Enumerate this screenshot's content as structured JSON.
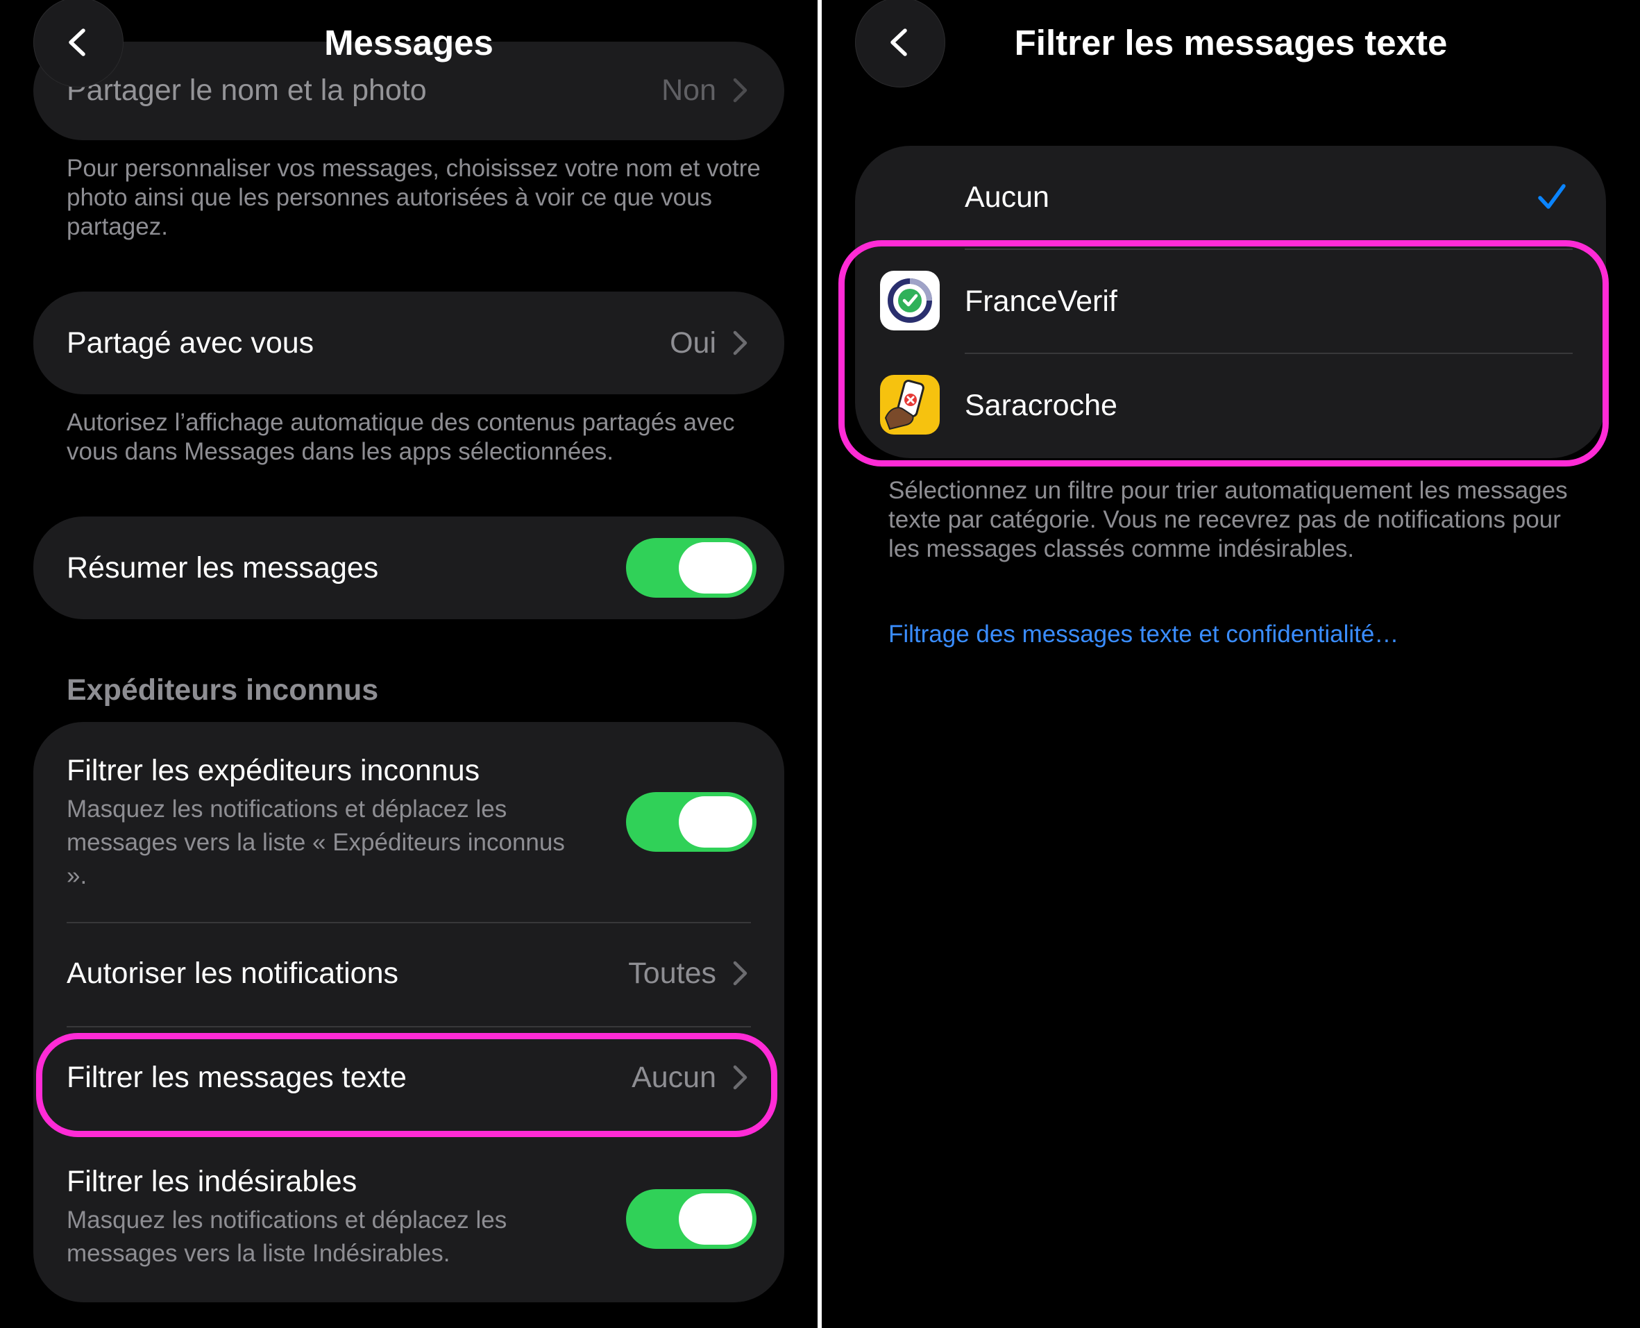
{
  "colors": {
    "accent": "#0a84ff",
    "toggle_on": "#30d158",
    "highlight": "#ff2bd6",
    "link": "#3a8dff"
  },
  "left": {
    "nav": {
      "back_icon": "chevron-left-icon",
      "title": "Messages"
    },
    "share_name": {
      "label": "Partager le nom et la photo",
      "value": "Non"
    },
    "share_name_footnote": "Pour personnaliser vos messages, choisissez votre nom et votre photo ainsi que les personnes autorisées à voir ce que vous partagez.",
    "shared_with_you": {
      "label": "Partagé avec vous",
      "value": "Oui"
    },
    "shared_with_you_footnote": "Autorisez l’affichage automatique des contenus partagés avec vous dans Messages dans les apps sélectionnées.",
    "summarize": {
      "label": "Résumer les messages",
      "on": true
    },
    "unknown_senders": {
      "header": "Expéditeurs inconnus",
      "filter_unknown": {
        "label": "Filtrer les expéditeurs inconnus",
        "description": "Masquez les notifications et déplacez les messages vers la liste « Expéditeurs inconnus ».",
        "on": true
      },
      "allow_notifications": {
        "label": "Autoriser les notifications",
        "value": "Toutes"
      },
      "filter_texts": {
        "label": "Filtrer les messages texte",
        "value": "Aucun"
      },
      "filter_junk": {
        "label": "Filtrer les indésirables",
        "description": "Masquez les notifications et déplacez les messages vers la liste Indésirables.",
        "on": true
      }
    }
  },
  "right": {
    "nav": {
      "back_icon": "chevron-left-icon",
      "title": "Filtrer les messages texte"
    },
    "options": [
      {
        "label": "Aucun",
        "selected": true,
        "icon": ""
      },
      {
        "label": "FranceVerif",
        "selected": false,
        "icon": "franceverif-app-icon"
      },
      {
        "label": "Saracroche",
        "selected": false,
        "icon": "saracroche-app-icon"
      }
    ],
    "footnote": "Sélectionnez un filtre pour trier automatiquement les messages texte par catégorie. Vous ne recevrez pas de notifications pour les messages classés comme indésirables.",
    "privacy_link": "Filtrage des messages texte et confidentialité…"
  }
}
